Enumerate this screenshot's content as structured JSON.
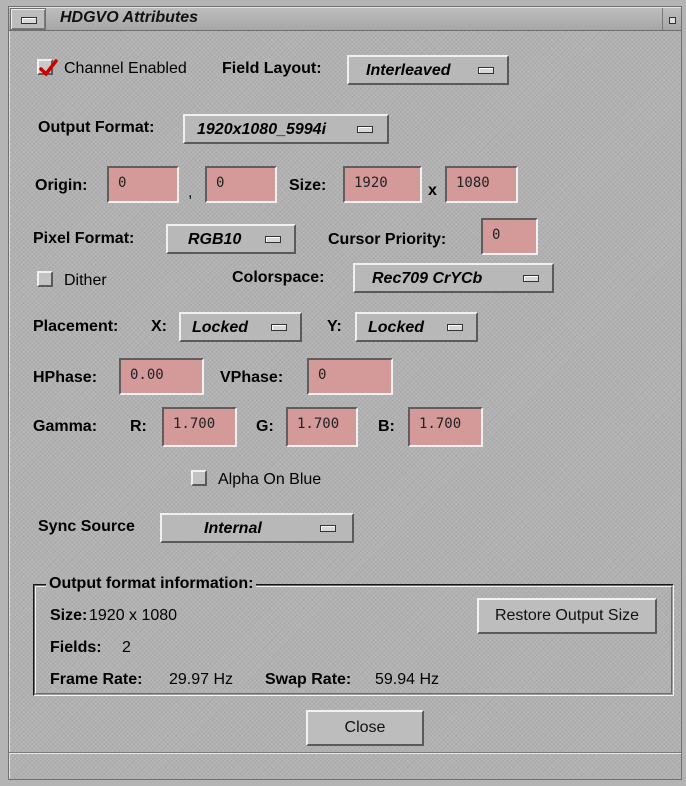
{
  "window": {
    "title": "HDGVO Attributes"
  },
  "channel_enabled": {
    "label": "Channel Enabled",
    "checked": true
  },
  "field_layout": {
    "label": "Field Layout:",
    "value": "Interleaved"
  },
  "output_format": {
    "label": "Output Format:",
    "value": "1920x1080_5994i"
  },
  "origin": {
    "label": "Origin:",
    "x": "0",
    "separator": ",",
    "y": "0"
  },
  "size": {
    "label": "Size:",
    "width": "1920",
    "times": "x",
    "height": "1080"
  },
  "pixel_format": {
    "label": "Pixel Format:",
    "value": "RGB10"
  },
  "cursor_priority": {
    "label": "Cursor Priority:",
    "value": "0"
  },
  "dither": {
    "label": "Dither",
    "checked": false
  },
  "colorspace": {
    "label": "Colorspace:",
    "value": "Rec709 CrYCb"
  },
  "placement": {
    "label": "Placement:",
    "x_label": "X:",
    "x_value": "Locked",
    "y_label": "Y:",
    "y_value": "Locked"
  },
  "hphase": {
    "label": "HPhase:",
    "value": "0.00"
  },
  "vphase": {
    "label": "VPhase:",
    "value": "0"
  },
  "gamma": {
    "label": "Gamma:",
    "r_label": "R:",
    "r": "1.700",
    "g_label": "G:",
    "g": "1.700",
    "b_label": "B:",
    "b": "1.700"
  },
  "alpha_on_blue": {
    "label": "Alpha On Blue",
    "checked": false
  },
  "sync_source": {
    "label": "Sync Source",
    "value": "Internal"
  },
  "info": {
    "legend": "Output format information:",
    "size_label": "Size:",
    "size_value": "1920 x 1080",
    "fields_label": "Fields:",
    "fields_value": "2",
    "frame_rate_label": "Frame Rate:",
    "frame_rate_value": "29.97 Hz",
    "swap_rate_label": "Swap Rate:",
    "swap_rate_value": "59.94 Hz",
    "restore_button": "Restore Output Size"
  },
  "close_button": "Close",
  "colors": {
    "field_bg": "#d49a9a",
    "window_bg": "#b1b1b1",
    "check_mark": "#cc0000"
  }
}
